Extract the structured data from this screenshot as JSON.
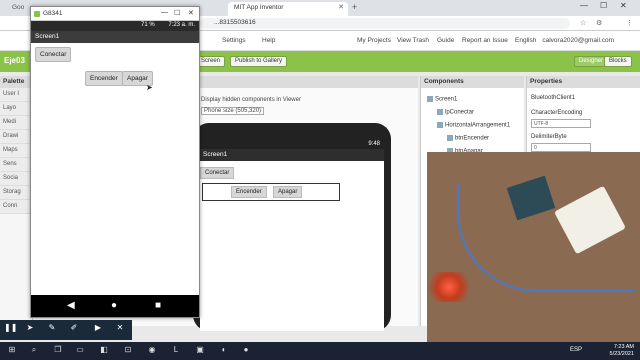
{
  "browser": {
    "tabs": [
      {
        "label": "Goo",
        "active": false
      },
      {
        "label": "MIT App Inventor",
        "active": true
      }
    ],
    "url": "...8315503616",
    "window_controls": [
      "—",
      "☐",
      "✕"
    ]
  },
  "appinventor": {
    "nav": [
      "My Projects",
      "View Trash",
      "Guide",
      "Report an Issue",
      "English",
      "Settings",
      "Help"
    ],
    "email": "calvora2020@gmail.com",
    "project_name": "Eje03",
    "toolbar_buttons": [
      "Screen",
      "Publish to Gallery"
    ],
    "mode_buttons": [
      "Designer",
      "Blocks"
    ],
    "palette_title": "Palette",
    "palette_items": [
      "User I",
      "Layo",
      "Medi",
      "Drawi",
      "Maps",
      "Sens",
      "Socia",
      "Storag",
      "Conn"
    ],
    "viewer": {
      "display_hidden": "Display hidden components in Viewer",
      "phone_size": "Phone size (505,320)",
      "phone_time": "9:48",
      "screen_title": "Screen1",
      "buttons": {
        "conectar": "Conectar",
        "encender": "Encender",
        "apagar": "Apagar"
      }
    },
    "components_title": "Components",
    "components": [
      "Screen1",
      "lpConectar",
      "HorizontalArrangement1",
      "btnEncender",
      "btnApagar"
    ],
    "properties_title": "Properties",
    "properties_component": "BluetoothClient1",
    "properties": [
      {
        "name": "CharacterEncoding",
        "value": "UTF-8"
      },
      {
        "name": "DelimiterByte",
        "value": "0"
      }
    ]
  },
  "emulator": {
    "window_title": "G8341",
    "status_time": "7:23 a. m.",
    "battery": "71 %",
    "screen_title": "Screen1",
    "buttons": {
      "conectar": "Conectar",
      "encender": "Encender",
      "apagar": "Apagar"
    }
  },
  "taskbar": {
    "language": "ESP",
    "time": "7:23 AM",
    "date": "5/23/2021"
  },
  "colors": {
    "accent": "#8bc34a"
  }
}
